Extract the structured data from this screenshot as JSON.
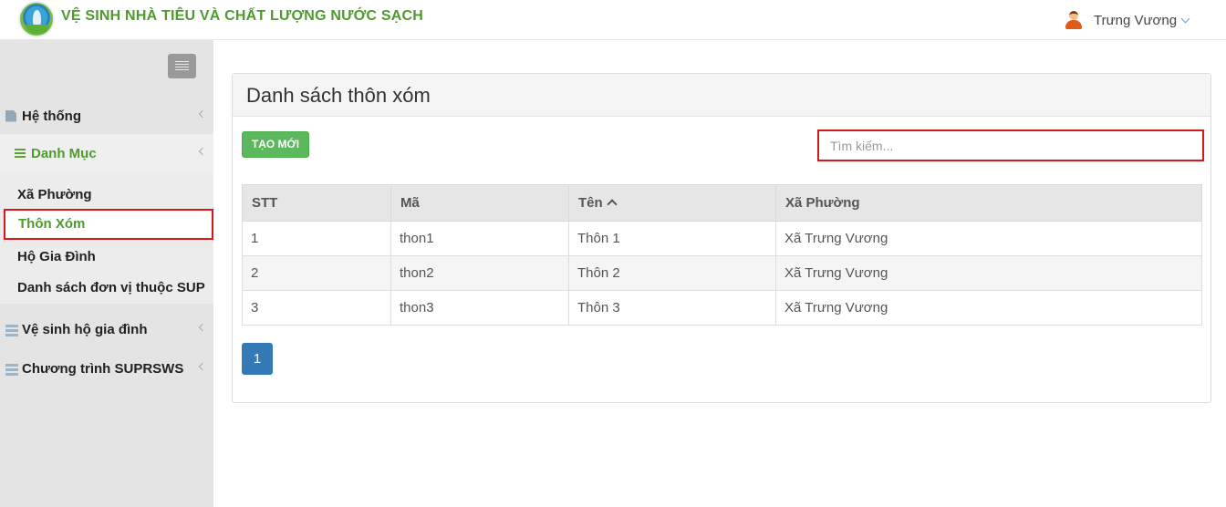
{
  "header": {
    "app_title": "VỆ SINH NHÀ TIÊU VÀ CHẤT LƯỢNG NƯỚC SẠCH",
    "user_name": "Trưng Vương"
  },
  "sidebar": {
    "items": [
      {
        "label": "Hệ thống",
        "icon": "document-icon"
      },
      {
        "label": "Danh Mục",
        "icon": "list-icon"
      },
      {
        "label": "Vệ sinh hộ gia đình",
        "icon": "server-icon"
      },
      {
        "label": "Chương trình SUPRSWS",
        "icon": "server-icon"
      }
    ],
    "sub_items": [
      {
        "label": "Xã Phường"
      },
      {
        "label": "Thôn Xóm"
      },
      {
        "label": "Hộ Gia Đình"
      },
      {
        "label": "Danh sách đơn vị thuộc SUP"
      }
    ]
  },
  "main": {
    "title": "Danh sách thôn xóm",
    "new_button": "TẠO MỚI",
    "search_placeholder": "Tìm kiếm...",
    "table": {
      "headers": [
        "STT",
        "Mã",
        "Tên",
        "Xã Phường"
      ],
      "rows": [
        [
          "1",
          "thon1",
          "Thôn 1",
          "Xã Trưng Vương"
        ],
        [
          "2",
          "thon2",
          "Thôn 2",
          "Xã Trưng Vương"
        ],
        [
          "3",
          "thon3",
          "Thôn 3",
          "Xã Trưng Vương"
        ]
      ]
    },
    "pagination": {
      "current_page": "1"
    }
  },
  "colors": {
    "brand_green": "#4e9a2f",
    "button_green": "#5cb85c",
    "pagination_blue": "#337ab7",
    "highlight_red": "#d9171b"
  }
}
